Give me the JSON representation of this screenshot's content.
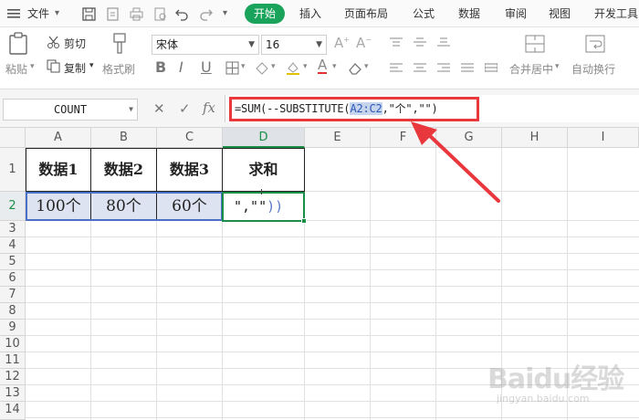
{
  "menubar": {
    "file_label": "文件",
    "active_tab": "开始",
    "tabs": [
      "插入",
      "页面布局",
      "公式",
      "数据",
      "审阅",
      "视图",
      "开发工具"
    ]
  },
  "ribbon": {
    "paste_label": "粘贴",
    "cut_label": "剪切",
    "copy_label": "复制",
    "format_painter_label": "格式刷",
    "font_name": "宋体",
    "font_size": "16",
    "merge_center_label": "合并居中",
    "wrap_text_label": "自动换行"
  },
  "formula_bar": {
    "name_box": "COUNT",
    "fx_label": "fx",
    "formula_prefix": "=SUM(--SUBSTITUTE(",
    "formula_range": "A2:C2",
    "formula_suffix": ",\"个\",\"\")"
  },
  "columns": [
    "A",
    "B",
    "C",
    "D",
    "E",
    "F",
    "G",
    "H",
    "I"
  ],
  "rows": [
    "1",
    "2",
    "3",
    "4",
    "5",
    "6",
    "7",
    "8",
    "9",
    "10",
    "11",
    "12",
    "13",
    "14"
  ],
  "table": {
    "headers": [
      "数据1",
      "数据2",
      "数据3",
      "求和"
    ],
    "values": [
      "100个",
      "80个",
      "60个"
    ],
    "editing_text_quote": "\",\"\"",
    "editing_text_parens": "))"
  },
  "watermark": {
    "brand": "Baidu经验",
    "url": "jingyan.baidu.com"
  },
  "colors": {
    "accent_green": "#1aa35b",
    "annotation_red": "#e8383d",
    "range_highlight": "#c6d4ee"
  }
}
